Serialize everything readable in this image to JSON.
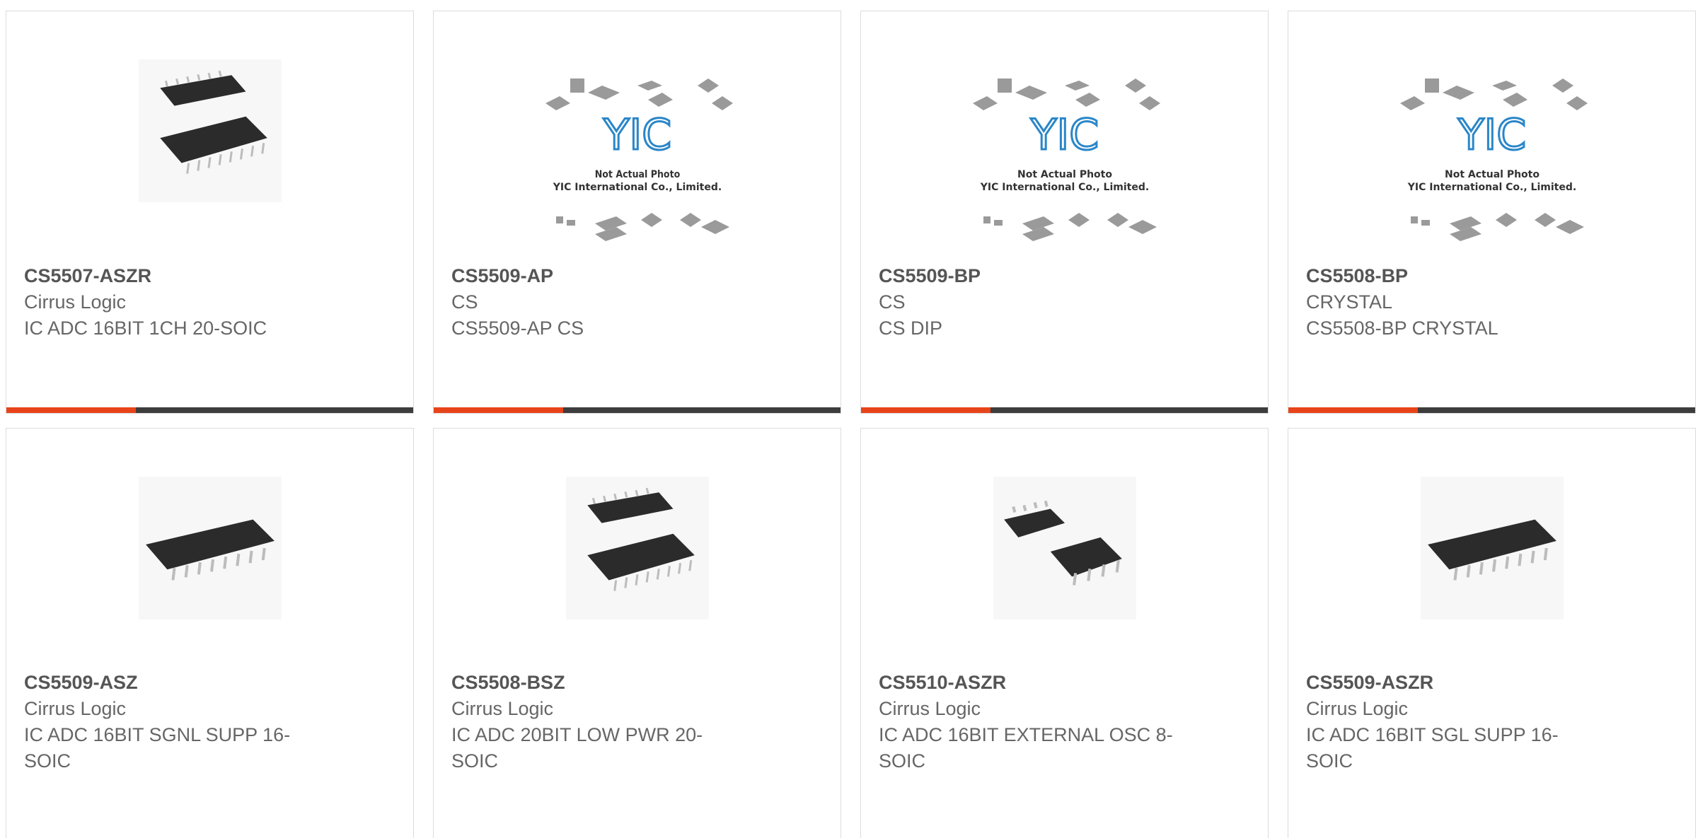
{
  "products": [
    {
      "part": "CS5507-ASZR",
      "manufacturer": "Cirrus Logic",
      "description": "IC ADC 16BIT 1CH 20-SOIC",
      "image": "soic-20-pair"
    },
    {
      "part": "CS5509-AP",
      "manufacturer": "CS",
      "description": "CS5509-AP CS",
      "image": "placeholder"
    },
    {
      "part": "CS5509-BP",
      "manufacturer": "CS",
      "description": "CS DIP",
      "image": "placeholder"
    },
    {
      "part": "CS5508-BP",
      "manufacturer": "CRYSTAL",
      "description": "CS5508-BP CRYSTAL",
      "image": "placeholder"
    },
    {
      "part": "CS5509-ASZ",
      "manufacturer": "Cirrus Logic",
      "description": "IC ADC 16BIT SGNL SUPP 16-SOIC",
      "image": "soic-16-single"
    },
    {
      "part": "CS5508-BSZ",
      "manufacturer": "Cirrus Logic",
      "description": "IC ADC 20BIT LOW PWR 20-SOIC",
      "image": "soic-20-pair"
    },
    {
      "part": "CS5510-ASZR",
      "manufacturer": "Cirrus Logic",
      "description": "IC ADC 16BIT EXTERNAL OSC 8-SOIC",
      "image": "soic-8-pair"
    },
    {
      "part": "CS5509-ASZR",
      "manufacturer": "Cirrus Logic",
      "description": "IC ADC 16BIT SGL SUPP 16-SOIC",
      "image": "soic-16-single"
    }
  ],
  "placeholder": {
    "logo": "YIC",
    "line1": "Not Actual Photo",
    "line2": "YIC International Co., Limited."
  },
  "colors": {
    "accent_bar": "#e8441a",
    "dark_bar": "#3d3d3d",
    "logo_blue": "#2a86c8"
  }
}
